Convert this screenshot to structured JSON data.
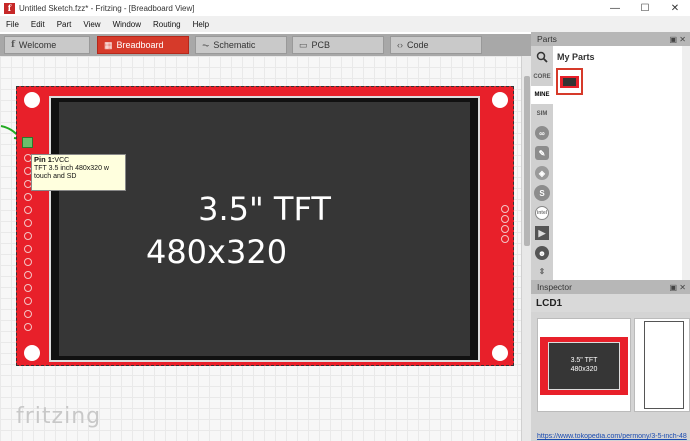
{
  "window": {
    "title": "Untitled Sketch.fzz* - Fritzing - [Breadboard View]",
    "app_icon": "f",
    "minimize": "—",
    "maximize": "☐",
    "close": "✕"
  },
  "menu": [
    "File",
    "Edit",
    "Part",
    "View",
    "Window",
    "Routing",
    "Help"
  ],
  "tabs": [
    {
      "label": "Welcome",
      "icon": "f"
    },
    {
      "label": "Breadboard",
      "icon": "▦"
    },
    {
      "label": "Schematic",
      "icon": "⏦"
    },
    {
      "label": "PCB",
      "icon": "▭"
    },
    {
      "label": "Code",
      "icon": "‹›"
    }
  ],
  "canvas": {
    "screen_line1": "3.5\" TFT",
    "screen_line2": "480x320",
    "tooltip_pin": "Pin 1:",
    "tooltip_pin_name": "VCC",
    "tooltip_desc": "TFT 3.5 inch 480x320 w touch and SD",
    "logo": "fritzing"
  },
  "parts": {
    "header": "Parts",
    "controls": "▣ ✕",
    "bins": [
      "search",
      "CORE",
      "MINE",
      "SIM",
      "arduino",
      "fab",
      "seeed",
      "sparkfun",
      "intel",
      "play",
      "snoo",
      "bin"
    ],
    "bin_labels": {
      "core": "CORE",
      "mine": "MINE",
      "sim": "SIM"
    },
    "title": "My Parts"
  },
  "inspector": {
    "header": "Inspector",
    "controls": "▣ ✕",
    "part_title": "LCD1",
    "preview_line1": "3.5\" TFT",
    "preview_line2": "480x320",
    "link": "https://www.tokopedia.com/permony/3-5-inch-48"
  }
}
